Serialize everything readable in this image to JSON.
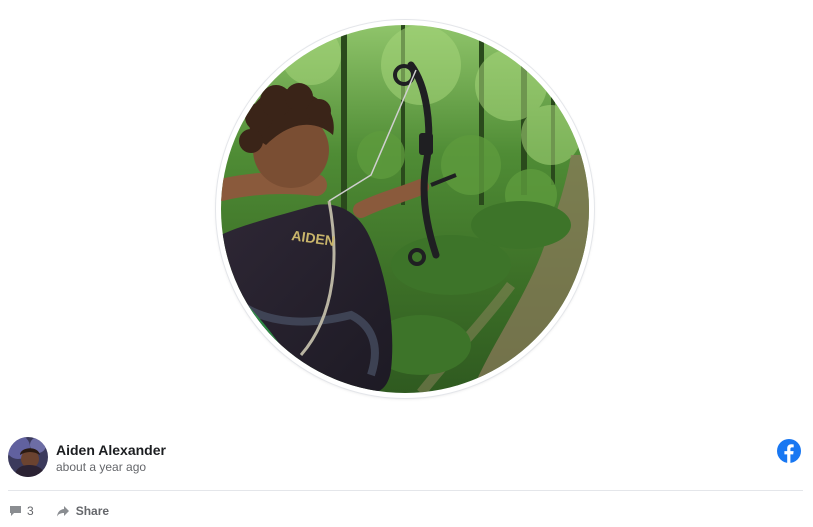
{
  "post": {
    "photo_alt": "Aiden Alexander",
    "author": {
      "name": "Aiden Alexander",
      "timestamp": "about a year ago"
    },
    "source_icon": "facebook-icon",
    "actions": {
      "comment_icon": "comment-icon",
      "comment_count": "3",
      "share_icon": "share-arrow-icon",
      "share_label": "Share"
    }
  },
  "colors": {
    "author_name": "#1c1e21",
    "muted_text": "#65676b",
    "facebook_blue": "#1877f2",
    "divider": "#e4e6ea"
  }
}
